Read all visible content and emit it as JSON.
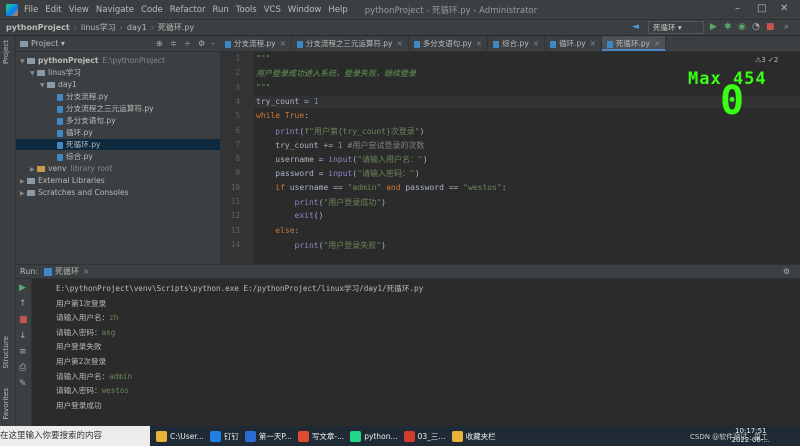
{
  "menubar": {
    "items": [
      "File",
      "Edit",
      "View",
      "Navigate",
      "Code",
      "Refactor",
      "Run",
      "Tools",
      "VCS",
      "Window",
      "Help"
    ],
    "title": "pythonProject - 死循环.py - Administrator"
  },
  "navbar": {
    "crumbs": [
      "pythonProject",
      "linus学习",
      "day1",
      "死循环.py"
    ],
    "run_config": "死循环"
  },
  "left_tool": {
    "project_tab": "Project",
    "structure_tab": "Structure",
    "favorites_tab": "Favorites"
  },
  "project": {
    "header": "Project",
    "rows": [
      {
        "label": "pythonProject",
        "extra": "E:\\pythonProject",
        "type": "folder",
        "depth": 0,
        "expanded": true
      },
      {
        "label": "linus学习",
        "type": "folder",
        "depth": 1,
        "expanded": true
      },
      {
        "label": "day1",
        "type": "folder",
        "depth": 2,
        "expanded": true
      },
      {
        "label": "分支流程.py",
        "type": "py",
        "depth": 3
      },
      {
        "label": "分支流程之三元运算符.py",
        "type": "py",
        "depth": 3
      },
      {
        "label": "多分支语句.py",
        "type": "py",
        "depth": 3
      },
      {
        "label": "循环.py",
        "type": "py",
        "depth": 3
      },
      {
        "label": "死循环.py",
        "type": "py",
        "depth": 3,
        "selected": true
      },
      {
        "label": "综合.py",
        "type": "py",
        "depth": 3
      },
      {
        "label": "venv",
        "extra": "library root",
        "type": "folder",
        "depth": 1
      },
      {
        "label": "External Libraries",
        "type": "lib",
        "depth": 0
      },
      {
        "label": "Scratches and Consoles",
        "type": "scratch",
        "depth": 0
      }
    ]
  },
  "editor": {
    "tabs": [
      {
        "label": "分支流程.py"
      },
      {
        "label": "分支流程之三元运算符.py"
      },
      {
        "label": "多分支语句.py"
      },
      {
        "label": "综合.py"
      },
      {
        "label": "循环.py"
      },
      {
        "label": "死循环.py",
        "active": true
      }
    ],
    "warnings": "⚠3 ✓2",
    "line_numbers": [
      "1",
      "2",
      "3",
      "4",
      "5",
      "6",
      "7",
      "8",
      "9",
      "10",
      "11",
      "12",
      "13",
      "14"
    ],
    "lines": [
      "\"\"\"",
      "用户登录成功进入系统，登录失败，继续登录",
      "\"\"\"",
      "try_count = 1",
      "while True:",
      "    print(f\"用户第{try_count}次登录\")",
      "    try_count += 1 #用户尝试登录的次数",
      "    username = input(\"请输入用户名：\")",
      "    password = input(\"请输入密码：\")",
      "    if username == \"admin\" and password == \"westos\":",
      "        print(\"用户登录成功\")",
      "        exit()",
      "    else:",
      "        print(\"用户登录失败\")"
    ],
    "overlay_max": "Max 454",
    "overlay_count": "0"
  },
  "run": {
    "label": "Run:",
    "config": "死循环",
    "output": [
      {
        "text": "E:\\pythonProject\\venv\\Scripts\\python.exe E:/pythonProject/linux学习/day1/死循环.py"
      },
      {
        "text": "用户第1次登录"
      },
      {
        "text": "请输入用户名：",
        "input": "zh"
      },
      {
        "text": "请输入密码：",
        "input": "asg"
      },
      {
        "text": "用户登录失败"
      },
      {
        "text": "用户第2次登录"
      },
      {
        "text": "请输入用户名：",
        "input": "admin"
      },
      {
        "text": "请输入密码：",
        "input": "westos"
      },
      {
        "text": "用户登录成功"
      }
    ]
  },
  "taskbar": {
    "search": "在这里输入你要搜索的内容",
    "apps": [
      {
        "label": "C:\\User...",
        "color": "#e8b339"
      },
      {
        "label": "钉钉",
        "color": "#1f7fe5"
      },
      {
        "label": "第一天P...",
        "color": "#2b6cd4"
      },
      {
        "label": "写文章-...",
        "color": "#e04a2f"
      },
      {
        "label": "python...",
        "color": "#21d789"
      },
      {
        "label": "03_三...",
        "color": "#d33b2c"
      },
      {
        "label": "收藏夹栏",
        "color": "#e8b339"
      }
    ],
    "time": "10:17:51",
    "date": "2022-06-..."
  },
  "watermark": "CSDN @软件测试 · 周工"
}
